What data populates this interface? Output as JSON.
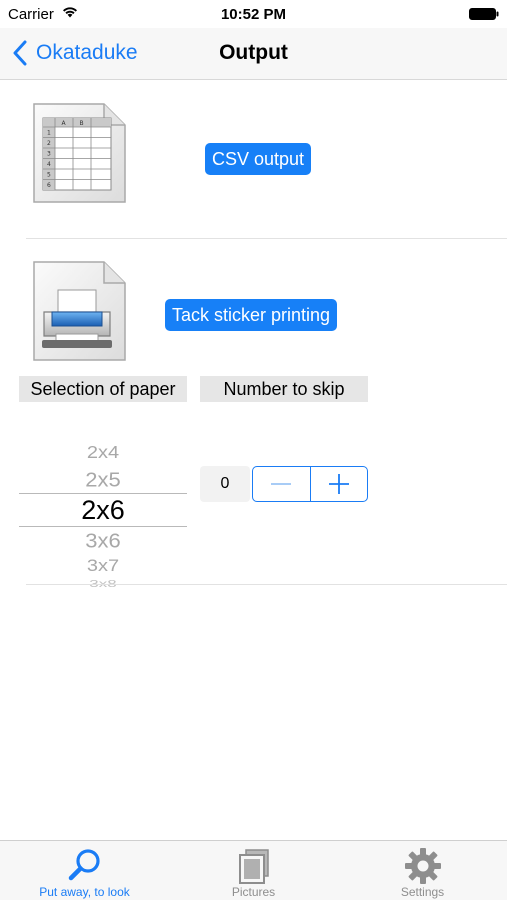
{
  "status_bar": {
    "carrier": "Carrier",
    "time": "10:52 PM"
  },
  "nav_bar": {
    "back_label": "Okataduke",
    "title": "Output"
  },
  "csv_section": {
    "icon": "spreadsheet-icon",
    "spreadsheet_columns": [
      "A",
      "B"
    ],
    "spreadsheet_rows": [
      "1",
      "2",
      "3",
      "4",
      "5",
      "6"
    ],
    "button_label": "CSV output"
  },
  "sticker_section": {
    "icon": "printer-icon",
    "button_label": "Tack sticker printing",
    "paper_header": "Selection of paper",
    "skip_header": "Number to skip",
    "paper_options": [
      "2x4",
      "2x5",
      "2x6",
      "3x6",
      "3x7",
      "3x8"
    ],
    "paper_selected": "2x6",
    "skip_value": "0"
  },
  "tab_bar": {
    "items": [
      {
        "label": "Put away, to look",
        "icon": "search-icon",
        "active": true
      },
      {
        "label": "Pictures",
        "icon": "pictures-icon",
        "active": false
      },
      {
        "label": "Settings",
        "icon": "gear-icon",
        "active": false
      }
    ]
  },
  "colors": {
    "accent": "#1a7cf5",
    "button_fill": "#1780f7",
    "header_fill": "#e6e6e6"
  }
}
